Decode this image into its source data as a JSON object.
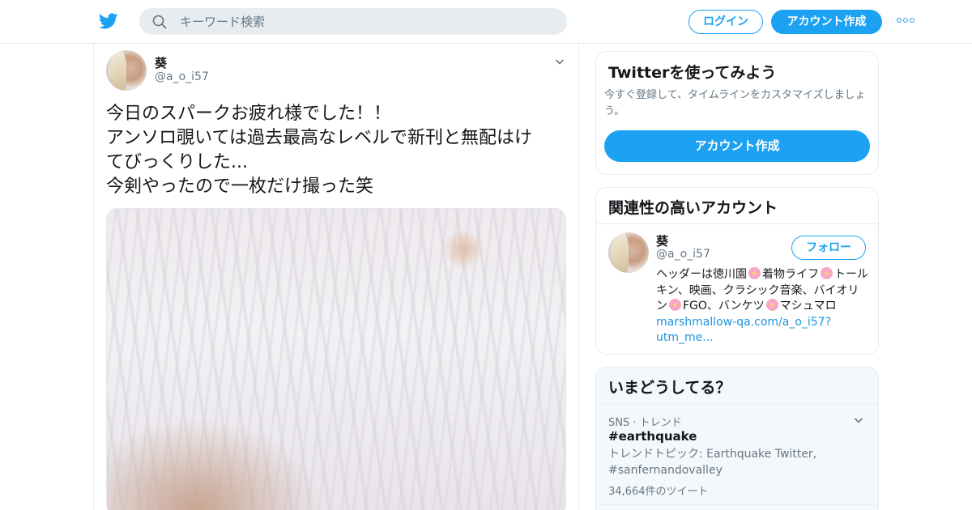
{
  "header": {
    "search_placeholder": "キーワード検索",
    "login_label": "ログイン",
    "signup_label": "アカウント作成",
    "logo_icon": "twitter-bird-icon",
    "more_icon": "more-dots-icon",
    "accent_color": "#1da1f2"
  },
  "tweet": {
    "author_name": "葵",
    "author_handle": "@a_o_i57",
    "text_lines": [
      "今日のスパークお疲れ様でした！！",
      "アンソロ覗いては過去最高なレベルで新刊と無配はけ",
      "てびっくりした...",
      "今剣やったので一枚だけ撮った笑"
    ],
    "menu_icon": "chevron-down-icon"
  },
  "sidebar": {
    "signup_card": {
      "title": "Twitterを使ってみよう",
      "subtitle": "今すぐ登録して、タイムラインをカスタマイズしましょう。",
      "button_label": "アカウント作成"
    },
    "related": {
      "title": "関連性の高いアカウント",
      "name": "葵",
      "handle": "@a_o_i57",
      "follow_label": "フォロー",
      "bio_parts": [
        "ヘッダーは徳川園",
        "着物ライフ",
        "トールキン、映画、クラシック音楽、バイオリン",
        "FGO、バンケツ",
        "マシュマロ"
      ],
      "bio_link": "marshmallow-qa.com/a_o_i57?utm_me..."
    },
    "trends": {
      "title": "いまどうしてる？",
      "meta": "SNS · トレンド",
      "tag": "#earthquake",
      "description": "トレンドトピック: Earthquake Twitter, #sanfernandovalley",
      "count": "34,664件のツイート"
    }
  }
}
